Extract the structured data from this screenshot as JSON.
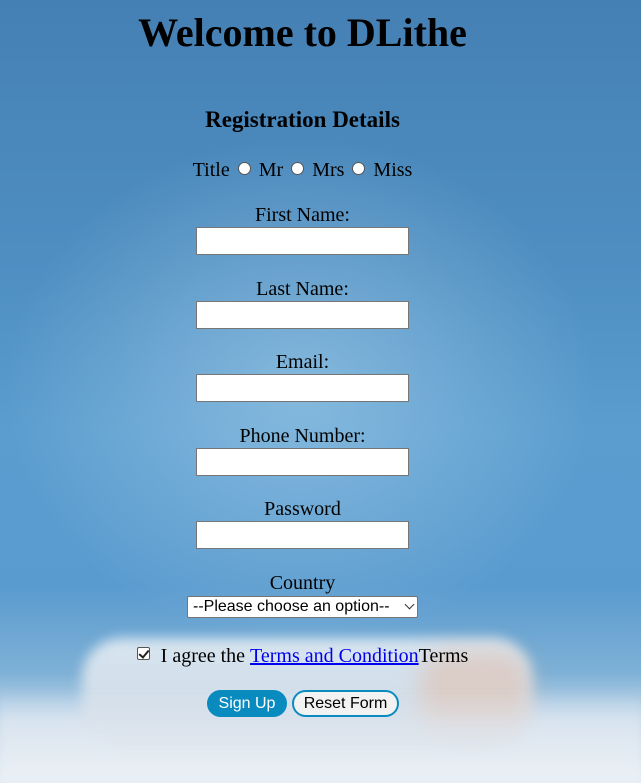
{
  "page": {
    "heading": "Welcome to DLithe",
    "subheading": "Registration Details"
  },
  "title_field": {
    "label": "Title",
    "options": [
      "Mr",
      "Mrs",
      "Miss"
    ]
  },
  "fields": {
    "first_name": {
      "label": "First Name:",
      "value": ""
    },
    "last_name": {
      "label": "Last Name:",
      "value": ""
    },
    "email": {
      "label": "Email:",
      "value": ""
    },
    "phone": {
      "label": "Phone Number:",
      "value": ""
    },
    "password": {
      "label": "Password",
      "value": ""
    }
  },
  "country": {
    "label": "Country",
    "selected": "--Please choose an option--"
  },
  "terms": {
    "checked": true,
    "prefix": "I agree the ",
    "link_text": "Terms and Condition",
    "suffix": "Terms"
  },
  "buttons": {
    "submit": "Sign Up",
    "reset": "Reset Form"
  },
  "colors": {
    "button_accent": "#0a8bc0",
    "link": "#0000ee",
    "background": "#4f8fc2"
  },
  "icons": {
    "select_arrow": "chevron-down-icon",
    "checkbox": "checkmark-icon"
  }
}
